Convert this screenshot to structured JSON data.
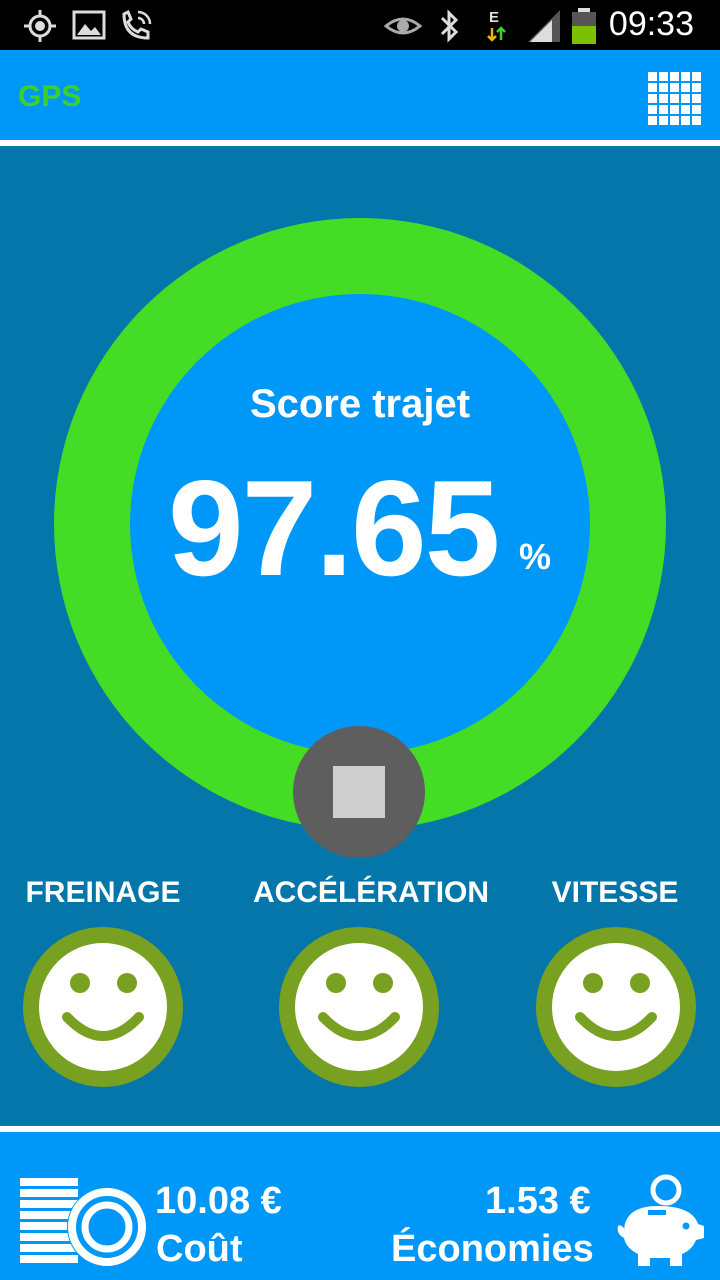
{
  "status_bar": {
    "time": "09:33",
    "icons": [
      "gps-icon",
      "gallery-icon",
      "phone-wifi-call-icon",
      "eye-icon",
      "bluetooth-icon",
      "data-e-icon",
      "signal-icon",
      "battery-icon"
    ]
  },
  "app_bar": {
    "title": "GPS",
    "menu_icon": "grid-menu-icon"
  },
  "score": {
    "label": "Score trajet",
    "value": "97.65",
    "unit": "%",
    "ring_color": "#45dc25",
    "inner_color": "#0098f8"
  },
  "stop_button": {
    "icon": "stop-icon"
  },
  "metrics": [
    {
      "label": "FREINAGE",
      "icon": "smiley-icon"
    },
    {
      "label": "ACCÉLÉRATION",
      "icon": "smiley-icon"
    },
    {
      "label": "VITESSE",
      "icon": "smiley-icon"
    }
  ],
  "footer": {
    "cost_value": "10.08 €",
    "cost_label": "Coût",
    "cost_icon": "coins-icon",
    "savings_value": "1.53 €",
    "savings_label": "Économies",
    "savings_icon": "piggy-bank-icon"
  },
  "colors": {
    "status_bar": "#000000",
    "app_bar": "#0098f8",
    "background": "#0576a9",
    "title_green": "#3ecf2f",
    "smiley_ring": "#78a021"
  }
}
